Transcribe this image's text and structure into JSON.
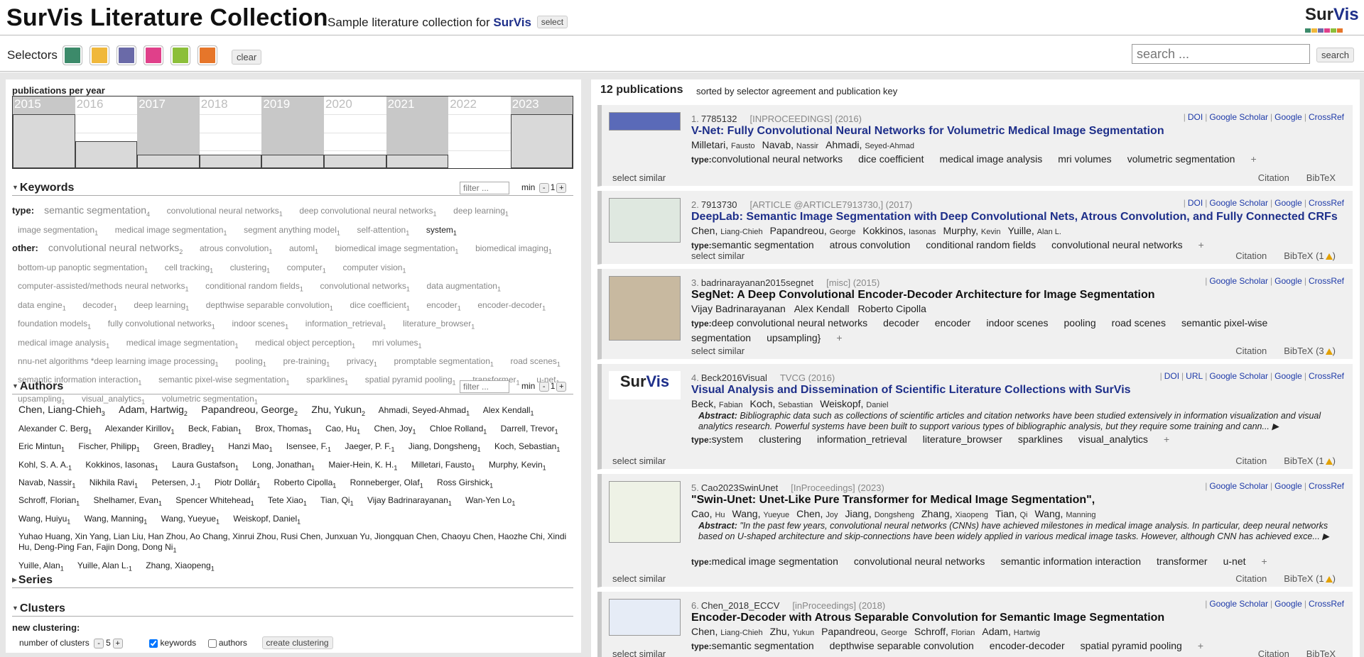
{
  "header": {
    "title": "SurVis Literature Collection",
    "subtitle": "Sample literature collection for",
    "brand": "SurVis",
    "select_label": "select",
    "logo_text_1": "Sur",
    "logo_text_2": "Vis"
  },
  "selectors": {
    "label": "Selectors",
    "colors": [
      "#3c8a6a",
      "#f0b83b",
      "#6a6aa8",
      "#e0408a",
      "#8cbf3a",
      "#e6762a"
    ],
    "clear_label": "clear",
    "search_placeholder": "search ...",
    "search_label": "search"
  },
  "timeline": {
    "title": "publications per year",
    "years": [
      {
        "label": "2015",
        "count": 2,
        "dark": true
      },
      {
        "label": "2016",
        "count": 1,
        "dark": false
      },
      {
        "label": "2017",
        "count": 0.5,
        "dark": true
      },
      {
        "label": "2018",
        "count": 0.5,
        "dark": false
      },
      {
        "label": "2019",
        "count": 0.5,
        "dark": true
      },
      {
        "label": "2020",
        "count": 0.5,
        "dark": false
      },
      {
        "label": "2021",
        "count": 0.5,
        "dark": true
      },
      {
        "label": "2022",
        "count": 0,
        "dark": false
      },
      {
        "label": "2023",
        "count": 2,
        "dark": true
      }
    ]
  },
  "keywords": {
    "title": "Keywords",
    "filter_placeholder": "filter ...",
    "min_label": "min",
    "min_value": "1",
    "type_label": "type:",
    "type_tags": [
      {
        "t": "semantic segmentation",
        "c": "4",
        "big": true
      },
      {
        "t": "convolutional neural networks",
        "c": "1"
      },
      {
        "t": "deep convolutional neural networks",
        "c": "1"
      },
      {
        "t": "deep learning",
        "c": "1"
      },
      {
        "t": "image segmentation",
        "c": "1"
      },
      {
        "t": "medical image segmentation",
        "c": "1"
      },
      {
        "t": "segment anything model",
        "c": "1"
      },
      {
        "t": "self-attention",
        "c": "1"
      },
      {
        "t": "system",
        "c": "1",
        "dark": true
      }
    ],
    "other_label": "other:",
    "other_tags": [
      {
        "t": "convolutional neural networks",
        "c": "2",
        "big": true
      },
      {
        "t": "atrous convolution",
        "c": "1"
      },
      {
        "t": "automl",
        "c": "1"
      },
      {
        "t": "biomedical image segmentation",
        "c": "1"
      },
      {
        "t": "biomedical imaging",
        "c": "1"
      },
      {
        "t": "bottom-up panoptic segmentation",
        "c": "1"
      },
      {
        "t": "cell tracking",
        "c": "1"
      },
      {
        "t": "clustering",
        "c": "1"
      },
      {
        "t": "computer",
        "c": "1"
      },
      {
        "t": "computer vision",
        "c": "1"
      },
      {
        "t": "computer-assisted/methods neural networks",
        "c": "1"
      },
      {
        "t": "conditional random fields",
        "c": "1"
      },
      {
        "t": "convolutional networks",
        "c": "1"
      },
      {
        "t": "data augmentation",
        "c": "1"
      },
      {
        "t": "data engine",
        "c": "1"
      },
      {
        "t": "decoder",
        "c": "1"
      },
      {
        "t": "deep learning",
        "c": "1"
      },
      {
        "t": "depthwise separable convolution",
        "c": "1"
      },
      {
        "t": "dice coefficient",
        "c": "1"
      },
      {
        "t": "encoder",
        "c": "1"
      },
      {
        "t": "encoder-decoder",
        "c": "1"
      },
      {
        "t": "foundation models",
        "c": "1"
      },
      {
        "t": "fully convolutional networks",
        "c": "1"
      },
      {
        "t": "indoor scenes",
        "c": "1"
      },
      {
        "t": "information_retrieval",
        "c": "1"
      },
      {
        "t": "literature_browser",
        "c": "1"
      },
      {
        "t": "medical image analysis",
        "c": "1"
      },
      {
        "t": "medical image segmentation",
        "c": "1"
      },
      {
        "t": "medical object perception",
        "c": "1"
      },
      {
        "t": "mri volumes",
        "c": "1"
      },
      {
        "t": "nnu-net algorithms *deep learning image processing",
        "c": "1"
      },
      {
        "t": "pooling",
        "c": "1"
      },
      {
        "t": "pre-training",
        "c": "1"
      },
      {
        "t": "privacy",
        "c": "1"
      },
      {
        "t": "promptable segmentation",
        "c": "1"
      },
      {
        "t": "road scenes",
        "c": "1"
      },
      {
        "t": "semantic information interaction",
        "c": "1"
      },
      {
        "t": "semantic pixel-wise segmentation",
        "c": "1"
      },
      {
        "t": "sparklines",
        "c": "1"
      },
      {
        "t": "spatial pyramid pooling",
        "c": "1"
      },
      {
        "t": "transformer",
        "c": "1"
      },
      {
        "t": "u-net",
        "c": "1"
      },
      {
        "t": "upsampling",
        "c": "1"
      },
      {
        "t": "visual_analytics",
        "c": "1"
      },
      {
        "t": "volumetric segmentation",
        "c": "1"
      }
    ]
  },
  "authors": {
    "title": "Authors",
    "filter_placeholder": "filter ...",
    "min_label": "min",
    "min_value": "1",
    "list": [
      {
        "n": "Chen, Liang-Chieh",
        "c": "3",
        "big": true
      },
      {
        "n": "Adam, Hartwig",
        "c": "2",
        "big": true
      },
      {
        "n": "Papandreou, George",
        "c": "2",
        "big": true
      },
      {
        "n": "Zhu, Yukun",
        "c": "2",
        "big": true
      },
      {
        "n": "Ahmadi, Seyed-Ahmad",
        "c": "1"
      },
      {
        "n": "Alex Kendall",
        "c": "1"
      },
      {
        "n": "Alexander C. Berg",
        "c": "1"
      },
      {
        "n": "Alexander Kirillov",
        "c": "1"
      },
      {
        "n": "Beck, Fabian",
        "c": "1"
      },
      {
        "n": "Brox, Thomas",
        "c": "1"
      },
      {
        "n": "Cao, Hu",
        "c": "1"
      },
      {
        "n": "Chen, Joy",
        "c": "1"
      },
      {
        "n": "Chloe Rolland",
        "c": "1"
      },
      {
        "n": "Darrell, Trevor",
        "c": "1"
      },
      {
        "n": "Eric Mintun",
        "c": "1"
      },
      {
        "n": "Fischer, Philipp",
        "c": "1"
      },
      {
        "n": "Green, Bradley",
        "c": "1"
      },
      {
        "n": "Hanzi Mao",
        "c": "1"
      },
      {
        "n": "Isensee, F.",
        "c": "1"
      },
      {
        "n": "Jaeger, P. F.",
        "c": "1"
      },
      {
        "n": "Jiang, Dongsheng",
        "c": "1"
      },
      {
        "n": "Koch, Sebastian",
        "c": "1"
      },
      {
        "n": "Kohl, S. A. A.",
        "c": "1"
      },
      {
        "n": "Kokkinos, Iasonas",
        "c": "1"
      },
      {
        "n": "Laura Gustafson",
        "c": "1"
      },
      {
        "n": "Long, Jonathan",
        "c": "1"
      },
      {
        "n": "Maier-Hein, K. H.",
        "c": "1"
      },
      {
        "n": "Milletari, Fausto",
        "c": "1"
      },
      {
        "n": "Murphy, Kevin",
        "c": "1"
      },
      {
        "n": "Navab, Nassir",
        "c": "1"
      },
      {
        "n": "Nikhila Ravi",
        "c": "1"
      },
      {
        "n": "Petersen, J.",
        "c": "1"
      },
      {
        "n": "Piotr Dollár",
        "c": "1"
      },
      {
        "n": "Roberto Cipolla",
        "c": "1"
      },
      {
        "n": "Ronneberger, Olaf",
        "c": "1"
      },
      {
        "n": "Ross Girshick",
        "c": "1"
      },
      {
        "n": "Schroff, Florian",
        "c": "1"
      },
      {
        "n": "Shelhamer, Evan",
        "c": "1"
      },
      {
        "n": "Spencer Whitehead",
        "c": "1"
      },
      {
        "n": "Tete Xiao",
        "c": "1"
      },
      {
        "n": "Tian, Qi",
        "c": "1"
      },
      {
        "n": "Vijay Badrinarayanan",
        "c": "1"
      },
      {
        "n": "Wan-Yen Lo",
        "c": "1"
      },
      {
        "n": "Wang, Huiyu",
        "c": "1"
      },
      {
        "n": "Wang, Manning",
        "c": "1"
      },
      {
        "n": "Wang, Yueyue",
        "c": "1"
      },
      {
        "n": "Weiskopf, Daniel",
        "c": "1"
      },
      {
        "n": "Yuhao Huang, Xin Yang, Lian Liu, Han Zhou, Ao Chang, Xinrui Zhou, Rusi Chen, Junxuan Yu, Jiongquan Chen, Chaoyu Chen, Haozhe Chi, Xindi Hu, Deng-Ping Fan, Fajin Dong, Dong Ni",
        "c": "1"
      },
      {
        "n": "Yuille, Alan",
        "c": "1"
      },
      {
        "n": "Yuille, Alan L.",
        "c": "1"
      },
      {
        "n": "Zhang, Xiaopeng",
        "c": "1"
      }
    ]
  },
  "series": {
    "title": "Series"
  },
  "clusters": {
    "title": "Clusters",
    "new_label": "new clustering:",
    "num_label": "number of clusters",
    "num_value": "5",
    "keywords_label": "keywords",
    "keywords_checked": true,
    "authors_label": "authors",
    "authors_checked": false,
    "create_label": "create clustering"
  },
  "publications": {
    "count_label": "12 publications",
    "sort_label": "sorted by selector agreement and publication key",
    "select_similar": "select similar",
    "citation_label": "Citation",
    "bibtex_label": "BibTeX",
    "items": [
      {
        "num": "1.",
        "key": "7785132",
        "meta": "[INPROCEEDINGS] (2016)",
        "links": [
          "DOI",
          "Google Scholar",
          "Google",
          "CrossRef"
        ],
        "title": "V-Net: Fully Convolutional Neural Networks for Volumetric Medical Image Segmentation",
        "authors": [
          [
            "Milletari,",
            "Fausto"
          ],
          [
            "Navab,",
            "Nassir"
          ],
          [
            "Ahmadi,",
            "Seyed-Ahmad"
          ]
        ],
        "abstract": "",
        "keywords": [
          "convolutional neural networks",
          "dice coefficient",
          "medical image analysis",
          "mri volumes",
          "volumetric segmentation"
        ],
        "warn": ""
      },
      {
        "num": "2.",
        "key": "7913730",
        "meta": "[ARTICLE @ARTICLE7913730,] (2017)",
        "links": [
          "DOI",
          "Google Scholar",
          "Google",
          "CrossRef"
        ],
        "title": "DeepLab: Semantic Image Segmentation with Deep Convolutional Nets, Atrous Convolution, and Fully Connected CRFs",
        "authors": [
          [
            "Chen,",
            "Liang-Chieh"
          ],
          [
            "Papandreou,",
            "George"
          ],
          [
            "Kokkinos,",
            "Iasonas"
          ],
          [
            "Murphy,",
            "Kevin"
          ],
          [
            "Yuille,",
            "Alan L."
          ]
        ],
        "abstract": "",
        "keywords": [
          "semantic segmentation",
          "atrous convolution",
          "conditional random fields",
          "convolutional neural networks"
        ],
        "warn": "1"
      },
      {
        "num": "3.",
        "key": "badrinarayanan2015segnet",
        "meta": "[misc] (2015)",
        "links": [
          "Google Scholar",
          "Google",
          "CrossRef"
        ],
        "title": "SegNet: A Deep Convolutional Encoder-Decoder Architecture for Image Segmentation",
        "authors": [
          [
            "Vijay Badrinarayanan",
            ""
          ],
          [
            "Alex Kendall",
            ""
          ],
          [
            "Roberto Cipolla",
            ""
          ]
        ],
        "abstract": "",
        "keywords": [
          "deep convolutional neural networks",
          "decoder",
          "encoder",
          "indoor scenes",
          "pooling",
          "road scenes",
          "semantic pixel-wise segmentation",
          "upsampling}"
        ],
        "warn": "3"
      },
      {
        "num": "4.",
        "key": "Beck2016Visual",
        "meta": "TVCG (2016)",
        "links": [
          "DOI",
          "URL",
          "Google Scholar",
          "Google",
          "CrossRef"
        ],
        "title": "Visual Analysis and Dissemination of Scientific Literature Collections with SurVis",
        "authors": [
          [
            "Beck,",
            "Fabian"
          ],
          [
            "Koch,",
            "Sebastian"
          ],
          [
            "Weiskopf,",
            "Daniel"
          ]
        ],
        "abstract_label": "Abstract:",
        "abstract": "Bibliographic data such as collections of scientific articles and citation networks have been studied extensively in information visualization and visual analytics research. Powerful systems have been built to support various types of bibliographic analysis, but they require some training and cann... ▶",
        "keywords": [
          "system",
          "clustering",
          "information_retrieval",
          "literature_browser",
          "sparklines",
          "visual_analytics"
        ],
        "warn": "1"
      },
      {
        "num": "5.",
        "key": "Cao2023SwinUnet",
        "meta": "[InProceedings] (2023)",
        "links": [
          "Google Scholar",
          "Google",
          "CrossRef"
        ],
        "title": "\"Swin-Unet: Unet-Like Pure Transformer for Medical Image Segmentation\",",
        "authors": [
          [
            "Cao,",
            "Hu"
          ],
          [
            "Wang,",
            "Yueyue"
          ],
          [
            "Chen,",
            "Joy"
          ],
          [
            "Jiang,",
            "Dongsheng"
          ],
          [
            "Zhang,",
            "Xiaopeng"
          ],
          [
            "Tian,",
            "Qi"
          ],
          [
            "Wang,",
            "Manning"
          ]
        ],
        "abstract_label": "Abstract:",
        "abstract": "\"In the past few years, convolutional neural networks (CNNs) have achieved milestones in medical image analysis. In particular, deep neural networks based on U-shaped architecture and skip-connections have been widely applied in various medical image tasks. However, although CNN has achieved exce... ▶",
        "keywords": [
          "medical image segmentation",
          "convolutional neural networks",
          "semantic information interaction",
          "transformer",
          "u-net"
        ],
        "warn": "1"
      },
      {
        "num": "6.",
        "key": "Chen_2018_ECCV",
        "meta": "[inProceedings] (2018)",
        "links": [
          "Google Scholar",
          "Google",
          "CrossRef"
        ],
        "title": "Encoder-Decoder with Atrous Separable Convolution for Semantic Image Segmentation",
        "authors": [
          [
            "Chen,",
            "Liang-Chieh"
          ],
          [
            "Zhu,",
            "Yukun"
          ],
          [
            "Papandreou,",
            "George"
          ],
          [
            "Schroff,",
            "Florian"
          ],
          [
            "Adam,",
            "Hartwig"
          ]
        ],
        "abstract": "",
        "keywords": [
          "semantic segmentation",
          "depthwise separable convolution",
          "encoder-decoder",
          "spatial pyramid pooling"
        ],
        "warn": ""
      }
    ]
  }
}
